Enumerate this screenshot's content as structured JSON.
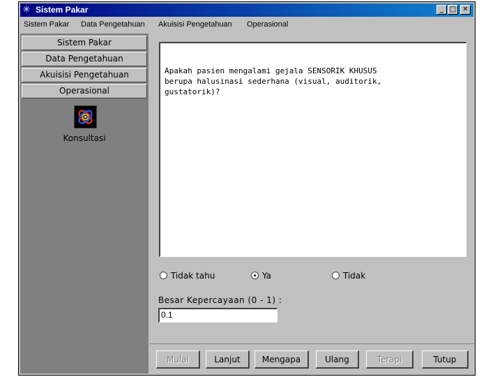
{
  "window": {
    "title": "Sistem Pakar"
  },
  "titlebar_buttons": {
    "minimize": "_",
    "maximize": "□",
    "close": "✕"
  },
  "menu": [
    "Sistem Pakar",
    "Data Pengetahuan",
    "Akuisisi Pengetahuan",
    "Operasional"
  ],
  "sidebar": {
    "items": [
      "Sistem Pakar",
      "Data Pengetahuan",
      "Akuisisi Pengetahuan",
      "Operasional"
    ],
    "launcher_label": "Konsultasi"
  },
  "question": {
    "text": "Apakah pasien mengalami gejala SENSORIK KHUSUS\nberupa halusinasi sederhana (visual, auditorik,\ngustatorik)?"
  },
  "answers": {
    "options": [
      "Tidak tahu",
      "Ya",
      "Tidak"
    ],
    "selected": "Ya"
  },
  "confidence": {
    "label": "Besar Kepercayaan (0 - 1) :",
    "value": "0.1"
  },
  "buttons": {
    "mulai": "Mulai",
    "lanjut": "Lanjut",
    "mengapa": "Mengapa",
    "ulang": "Ulang",
    "terapi": "Terapi",
    "tutup": "Tutup",
    "disabled": [
      "Mulai",
      "Terapi"
    ]
  }
}
